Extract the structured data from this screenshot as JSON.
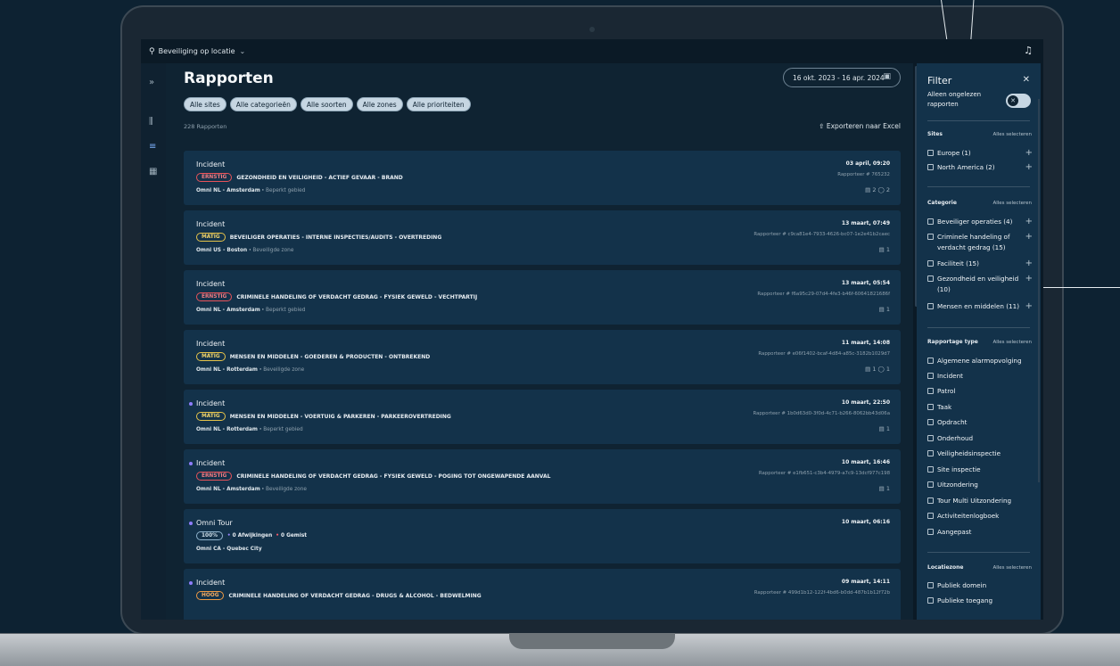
{
  "topbar": {
    "location_label": "Beveiliging op locatie"
  },
  "page": {
    "title": "Rapporten",
    "count_label": "228 Rapporten",
    "date_range": "16 okt. 2023 - 16 apr. 2024",
    "export_label": "Exporteren naar Excel"
  },
  "chips": [
    "Alle sites",
    "Alle categorieën",
    "Alle soorten",
    "Alle zones",
    "Alle prioriteiten"
  ],
  "cards": [
    {
      "type": "Incident",
      "badge": "ERNSTIG",
      "badge_color": "red",
      "category": "GEZONDHEID EN VEILIGHEID - ACTIEF GEVAAR - BRAND",
      "site": "Omni NL - Amsterdam",
      "zone": "Beperkt gebied",
      "date": "03 april, 09:20",
      "report": "Rapporteer # 765232",
      "attachments": "▤ 2  ◯ 2",
      "unread": false
    },
    {
      "type": "Incident",
      "badge": "MATIG",
      "badge_color": "yellow",
      "category": "BEVEILIGER OPERATIES - INTERNE INSPECTIES/AUDITS - OVERTREDING",
      "site": "Omni US - Boston",
      "zone": "Beveiligde zone",
      "date": "13 maart, 07:49",
      "report": "Rapporteer # c9ca81e4-7933-4626-bc07-1e2e41b2caec",
      "attachments": "▤ 1",
      "unread": false
    },
    {
      "type": "Incident",
      "badge": "ERNSTIG",
      "badge_color": "red",
      "category": "CRIMINELE HANDELING OF VERDACHT GEDRAG - FYSIEK GEWELD - VECHTPARTIJ",
      "site": "Omni NL - Amsterdam",
      "zone": "Beperkt gebied",
      "date": "13 maart, 05:54",
      "report": "Rapporteer # f6a95c29-07d4-4fe3-b46f-60641821686f",
      "attachments": "▤ 1",
      "unread": false
    },
    {
      "type": "Incident",
      "badge": "MATIG",
      "badge_color": "yellow",
      "category": "MENSEN EN MIDDELEN - GOEDEREN & PRODUCTEN - ONTBREKEND",
      "site": "Omni NL - Rotterdam",
      "zone": "Beveiligde zone",
      "date": "11 maart, 14:08",
      "report": "Rapporteer # e06f1402-bcaf-4d84-a85c-3182b1029d7",
      "attachments": "▤ 1  ◯ 1",
      "unread": false
    },
    {
      "type": "Incident",
      "badge": "MATIG",
      "badge_color": "yellow",
      "category": "MENSEN EN MIDDELEN - VOERTUIG & PARKEREN - PARKEEROVERTREDING",
      "site": "Omni NL - Rotterdam",
      "zone": "Beperkt gebied",
      "date": "10 maart, 22:50",
      "report": "Rapporteer # 1b0d63d0-3f0d-4c71-b266-8062bb43d06a",
      "attachments": "▤ 1",
      "unread": true
    },
    {
      "type": "Incident",
      "badge": "ERNSTIG",
      "badge_color": "red",
      "category": "CRIMINELE HANDELING OF VERDACHT GEDRAG - FYSIEK GEWELD - POGING TOT ONGEWAPENDE AANVAL",
      "site": "Omni NL - Amsterdam",
      "zone": "Beveiligde zone",
      "date": "10 maart, 16:46",
      "report": "Rapporteer # e1fb651-c3b4-4979-a7c9-13dcf977c198",
      "attachments": "▤ 1",
      "unread": true
    },
    {
      "type": "Omni Tour",
      "badge": "100%",
      "badge_color": "blue",
      "tour_deviations": "0 Afwijkingen",
      "tour_missed": "0 Gemist",
      "site": "Omni CA - Quebec City",
      "zone": "",
      "date": "10 maart, 06:16",
      "report": "",
      "attachments": "",
      "unread": true
    },
    {
      "type": "Incident",
      "badge": "HOOG",
      "badge_color": "orange",
      "category": "CRIMINELE HANDELING OF VERDACHT GEDRAG - DRUGS & ALCOHOL - BEDWELMING",
      "site": "",
      "zone": "",
      "date": "09 maart, 14:11",
      "report": "Rapporteer # 499d1b12-122f-4bd6-b0dd-487b1b12f72b",
      "attachments": "",
      "unread": true
    }
  ],
  "filter": {
    "title": "Filter",
    "unread_label": "Alleen ongelezen rapporten",
    "select_all": "Alles selecteren",
    "sites_title": "Sites",
    "sites": [
      "Europe (1)",
      "North America (2)"
    ],
    "category_title": "Categorie",
    "categories": [
      "Beveiliger operaties (4)",
      "Criminele handeling of verdacht gedrag (15)",
      "Faciliteit (15)",
      "Gezondheid en veiligheid (10)",
      "Mensen en middelen (11)"
    ],
    "report_type_title": "Rapportage type",
    "report_types": [
      "Algemene alarmopvolging",
      "Incident",
      "Patrol",
      "Taak",
      "Opdracht",
      "Onderhoud",
      "Veiligheidsinspectie",
      "Site inspectie",
      "Uitzondering",
      "Tour Multi Uitzondering",
      "Activiteitenlogboek",
      "Aangepast"
    ],
    "zone_title": "Locatiezone",
    "zones": [
      "Publiek domein",
      "Publieke toegang"
    ]
  }
}
